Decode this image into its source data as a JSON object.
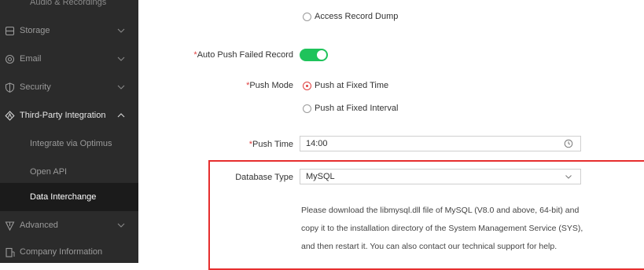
{
  "sidebar": {
    "clipped_item": "Audio & Recordings",
    "items": [
      {
        "label": "Storage",
        "icon": "storage-icon"
      },
      {
        "label": "Email",
        "icon": "email-icon"
      },
      {
        "label": "Security",
        "icon": "shield-icon"
      },
      {
        "label": "Third-Party Integration",
        "icon": "integration-icon"
      },
      {
        "label": "Advanced",
        "icon": "advanced-icon"
      },
      {
        "label": "Company Information",
        "icon": "company-icon"
      }
    ],
    "sub_items": [
      {
        "label": "Integrate via Optimus"
      },
      {
        "label": "Open API"
      },
      {
        "label": "Data Interchange"
      }
    ]
  },
  "form": {
    "access_dump_label": "Access Record Dump",
    "auto_push": {
      "required_mark": "*",
      "label": "Auto Push Failed Record",
      "enabled": true
    },
    "push_mode": {
      "required_mark": "*",
      "label": "Push Mode",
      "options": [
        "Push at Fixed Time",
        "Push at Fixed Interval"
      ],
      "selected": "Push at Fixed Time"
    },
    "push_time": {
      "required_mark": "*",
      "label": "Push Time",
      "value": "14:00"
    },
    "database_type": {
      "label": "Database Type",
      "value": "MySQL"
    },
    "help_lines": [
      "Please download the libmysql.dll file of MySQL (V8.0 and above, 64-bit) and",
      "copy it to the installation directory of the System Management Service (SYS),",
      "and then restart it. You can also contact our technical support for help."
    ]
  },
  "colors": {
    "sidebar_bg": "#2b2b2b",
    "active_bg": "#1b1b1b",
    "toggle_on": "#1fc35b",
    "required": "#e04040",
    "highlight_border": "#e62e2e"
  }
}
